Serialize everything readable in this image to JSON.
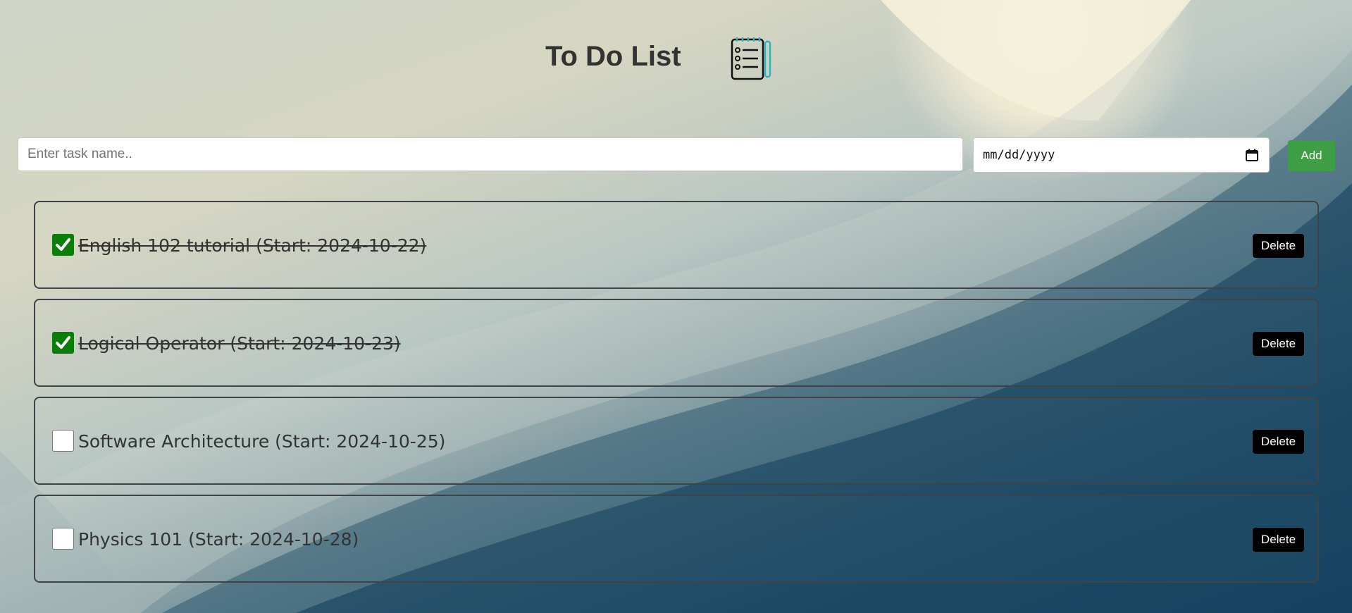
{
  "header": {
    "title": "To Do List",
    "icon": "notepad-checklist-icon"
  },
  "form": {
    "task_placeholder": "Enter task name..",
    "task_value": "",
    "date_placeholder": "mm/dd/yyyy",
    "add_label": "Add"
  },
  "tasks": [
    {
      "text": "English 102 tutorial (Start: 2024-10-22)",
      "done": true
    },
    {
      "text": "Logical Operator (Start: 2024-10-23)",
      "done": true
    },
    {
      "text": "Software Architecture (Start: 2024-10-25)",
      "done": false
    },
    {
      "text": "Physics 101 (Start: 2024-10-28)",
      "done": false
    }
  ],
  "labels": {
    "delete": "Delete"
  },
  "colors": {
    "add_button": "#3e9e45",
    "check_done": "#0a7d0a",
    "delete_button": "#000000",
    "title_text": "#333333"
  }
}
